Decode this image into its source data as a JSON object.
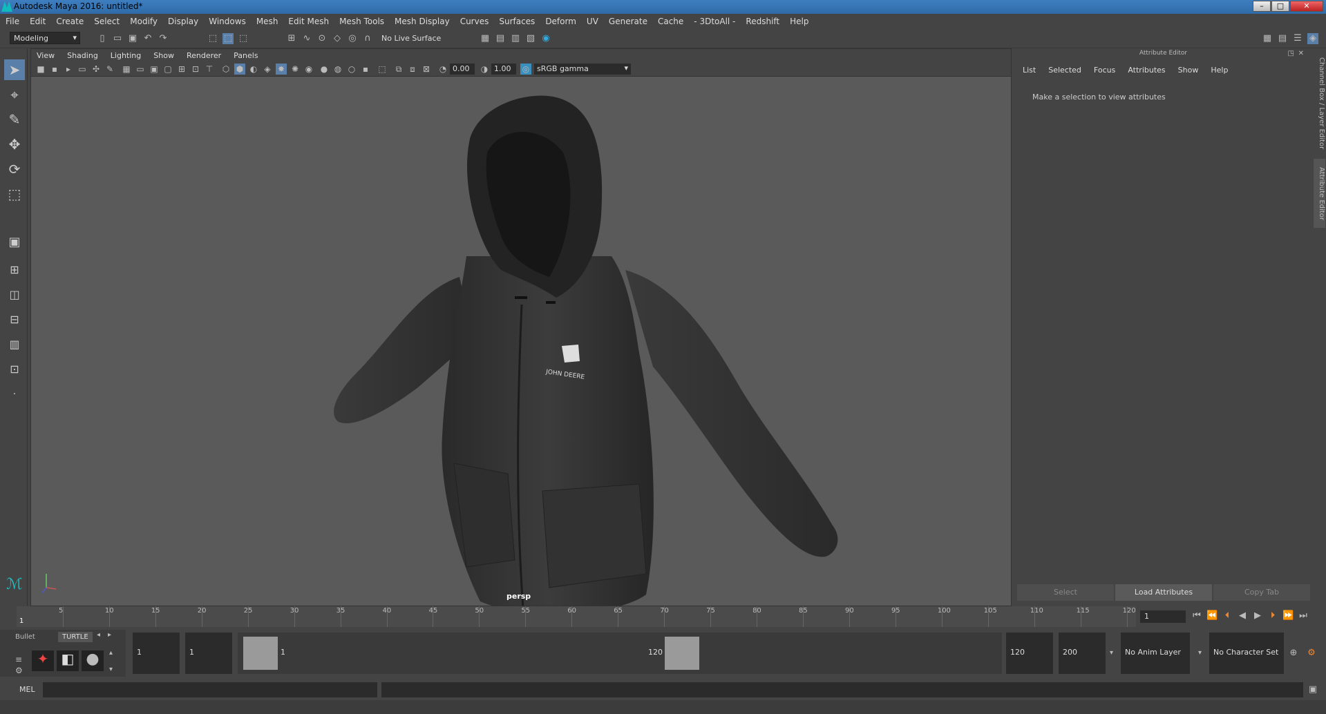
{
  "window": {
    "title": "Autodesk Maya 2016: untitled*",
    "controls": [
      "–",
      "□",
      "✕"
    ]
  },
  "menubar": [
    "File",
    "Edit",
    "Create",
    "Select",
    "Modify",
    "Display",
    "Windows",
    "Mesh",
    "Edit Mesh",
    "Mesh Tools",
    "Mesh Display",
    "Curves",
    "Surfaces",
    "Deform",
    "UV",
    "Generate",
    "Cache",
    "- 3DtoAll -",
    "Redshift",
    "Help"
  ],
  "statusline": {
    "mode": "Modeling",
    "live_surface": "No Live Surface"
  },
  "viewport": {
    "menu": [
      "View",
      "Shading",
      "Lighting",
      "Show",
      "Renderer",
      "Panels"
    ],
    "exposure": "0.00",
    "gamma": "1.00",
    "color_space": "sRGB gamma",
    "camera_label": "persp",
    "logo_text": "JOHN DEERE"
  },
  "attribute_editor": {
    "title": "Attribute Editor",
    "menu": [
      "List",
      "Selected",
      "Focus",
      "Attributes",
      "Show",
      "Help"
    ],
    "message": "Make a selection to view attributes",
    "buttons": [
      "Select",
      "Load Attributes",
      "Copy Tab"
    ],
    "side_tabs": [
      "Channel Box / Layer Editor",
      "Attribute Editor"
    ]
  },
  "timeslider": {
    "ticks": [
      "5",
      "10",
      "15",
      "20",
      "25",
      "30",
      "35",
      "40",
      "45",
      "50",
      "55",
      "60",
      "65",
      "70",
      "75",
      "80",
      "85",
      "90",
      "95",
      "100",
      "105",
      "110",
      "115",
      "120"
    ],
    "start_marker": "1",
    "current_frame": "1"
  },
  "range": {
    "shelf_tabs": [
      "Bullet",
      "TURTLE"
    ],
    "start": "1",
    "playback_start": "1",
    "range_start_label": "1",
    "range_end_label": "120",
    "playback_end": "120",
    "end": "200",
    "anim_layer": "No Anim Layer",
    "character_set": "No Character Set"
  },
  "command": {
    "label": "MEL"
  }
}
